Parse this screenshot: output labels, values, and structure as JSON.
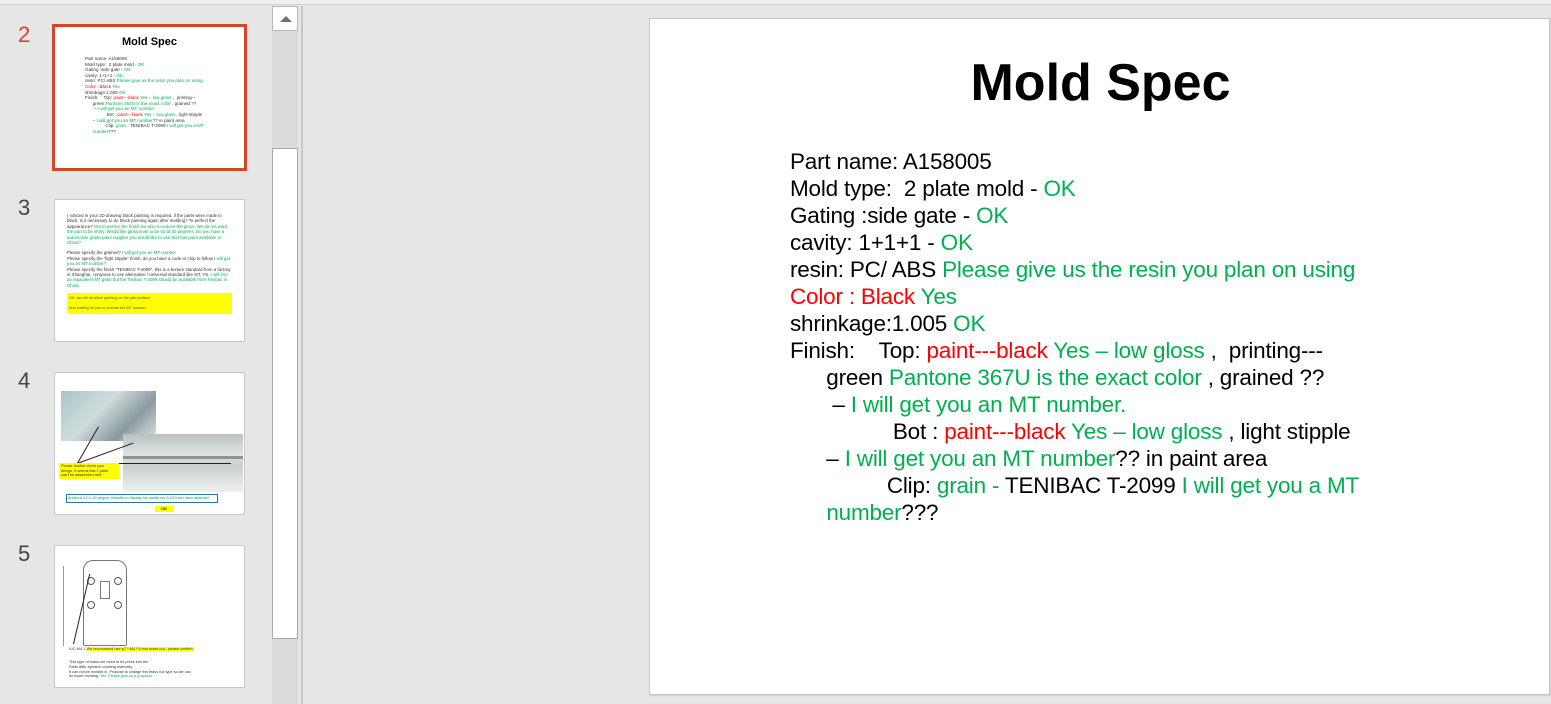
{
  "thumbnails": [
    {
      "number": "2",
      "active": true,
      "title": "Mold Spec",
      "lines": [
        "Part name: A158005",
        "Mold type:  2 plate mold - OK",
        "Gating :side gate - OK",
        "cavity: 1+1+1 - OK",
        "resin: PC/ ABS Please give us the resin you plan on using",
        "Color : Black Yes",
        "shrinkage:1.005 OK",
        "Finish:    Top: paint---black Yes – low gloss ,  printing---",
        "      green Pantone 367U is the exact color , grained ??",
        "       – I will get you an MT number.",
        "              Bot : paint---black Yes – low gloss , light stipple",
        "      – I will get you an MT number?? in paint area",
        "              Clip: grain - TENIBAC T-2099 I will get you a MT",
        "      number???"
      ]
    },
    {
      "number": "3",
      "paragraphs": [
        {
          "black": "I noticed in your 2D drawing black painting is required, if the parts were made in black, is it necessary to do black painting again after molding?   To perfect the appearance?",
          "green": " Yes to perfect the finish but also to reduce the gloss. We do not want the part to be shiny. Would like gloss level to be 02 at 60 degrees. Do you have a automotive grade paint supplier you would like to use that has paint available in China?"
        },
        {
          "black": "Please specify the grained?",
          "green": " I will get you an MT number"
        },
        {
          "black": "Please specify the \"light stipple\" finish, do you have a code or chip to follow I",
          "green": " will get you an MT number?"
        },
        {
          "black": "Please specify the finish \"TENIBAC T-2099\", this is a texture standard from a factory in Shanghai, I propose to use alternative / universal standard like MT, YS.",
          "green": " I will find an equivalent MT grain but the Tenibac T-2099 should be available from Tenibac in China."
        }
      ],
      "highlight_lines": [
        "OK, we will do black painting on the part surface.",
        "And waiting for you to provide the MT number."
      ]
    },
    {
      "number": "4",
      "note": "Please double check your design, it seems this 2 parts can't be assembled well.",
      "box_text": "Added a 1.0 x 30 degree chamfer to display top model rev A-03 that I have attached",
      "ok_label": "OK"
    },
    {
      "number": "5",
      "label_prefix": "IUC-M4-1",
      "highlight": "We recommend use φ7 * M4 * 5 mm  brass nut ,   please confirm.",
      "body_lines": [
        "This type of brass nut need to be press into the",
        "Parts after injection molding manually.",
        "It can not be molded in, Propose to change the brass nut type so we can"
      ],
      "last_black": "do insert molding. ",
      "last_green": "Yes. Please give us a proposal."
    }
  ],
  "slide": {
    "title": "Mold Spec",
    "lines": [
      [
        {
          "t": "Part name: A158005",
          "c": "k"
        }
      ],
      [
        {
          "t": "Mold type:  2 plate mold - ",
          "c": "k"
        },
        {
          "t": "OK",
          "c": "g"
        }
      ],
      [
        {
          "t": "Gating :side gate - ",
          "c": "k"
        },
        {
          "t": "OK",
          "c": "g"
        }
      ],
      [
        {
          "t": "cavity: 1+1+1 - ",
          "c": "k"
        },
        {
          "t": "OK",
          "c": "g"
        }
      ],
      [
        {
          "t": "resin: PC/ ABS ",
          "c": "k"
        },
        {
          "t": "Please give us the resin you plan on using",
          "c": "g"
        }
      ],
      [
        {
          "t": "Color : Black ",
          "c": "r"
        },
        {
          "t": "Yes",
          "c": "g"
        }
      ],
      [
        {
          "t": "shrinkage:1.005 ",
          "c": "k"
        },
        {
          "t": "OK",
          "c": "g"
        }
      ],
      [
        {
          "t": "Finish:    Top: ",
          "c": "k"
        },
        {
          "t": "paint---black",
          "c": "r"
        },
        {
          "t": " Yes – low gloss",
          "c": "g"
        },
        {
          "t": " ,  printing---",
          "c": "k"
        }
      ],
      [
        {
          "t": "      green ",
          "c": "k"
        },
        {
          "t": "Pantone 367U is the exact color",
          "c": "g"
        },
        {
          "t": " , grained ??",
          "c": "k"
        }
      ],
      [
        {
          "t": "       – ",
          "c": "k"
        },
        {
          "t": "I will get you an MT number.",
          "c": "g"
        }
      ],
      [
        {
          "t": "                 Bot : ",
          "c": "k"
        },
        {
          "t": "paint---black",
          "c": "r"
        },
        {
          "t": " Yes – low gloss",
          "c": "g"
        },
        {
          "t": " , light stipple",
          "c": "k"
        }
      ],
      [
        {
          "t": "      – ",
          "c": "k"
        },
        {
          "t": "I will get you an MT number",
          "c": "g"
        },
        {
          "t": "?? in paint area",
          "c": "k"
        }
      ],
      [
        {
          "t": "                Clip: ",
          "c": "k"
        },
        {
          "t": "grain - ",
          "c": "g"
        },
        {
          "t": "TENIBAC T-2099 ",
          "c": "k"
        },
        {
          "t": "I will get you a MT",
          "c": "g"
        }
      ],
      [
        {
          "t": "      ",
          "c": "k"
        },
        {
          "t": "number",
          "c": "g"
        },
        {
          "t": "???",
          "c": "k"
        }
      ]
    ]
  },
  "colors": {
    "accent": "#d24726",
    "green": "#00b050",
    "red": "#ff0000",
    "highlight": "#ffff00"
  }
}
